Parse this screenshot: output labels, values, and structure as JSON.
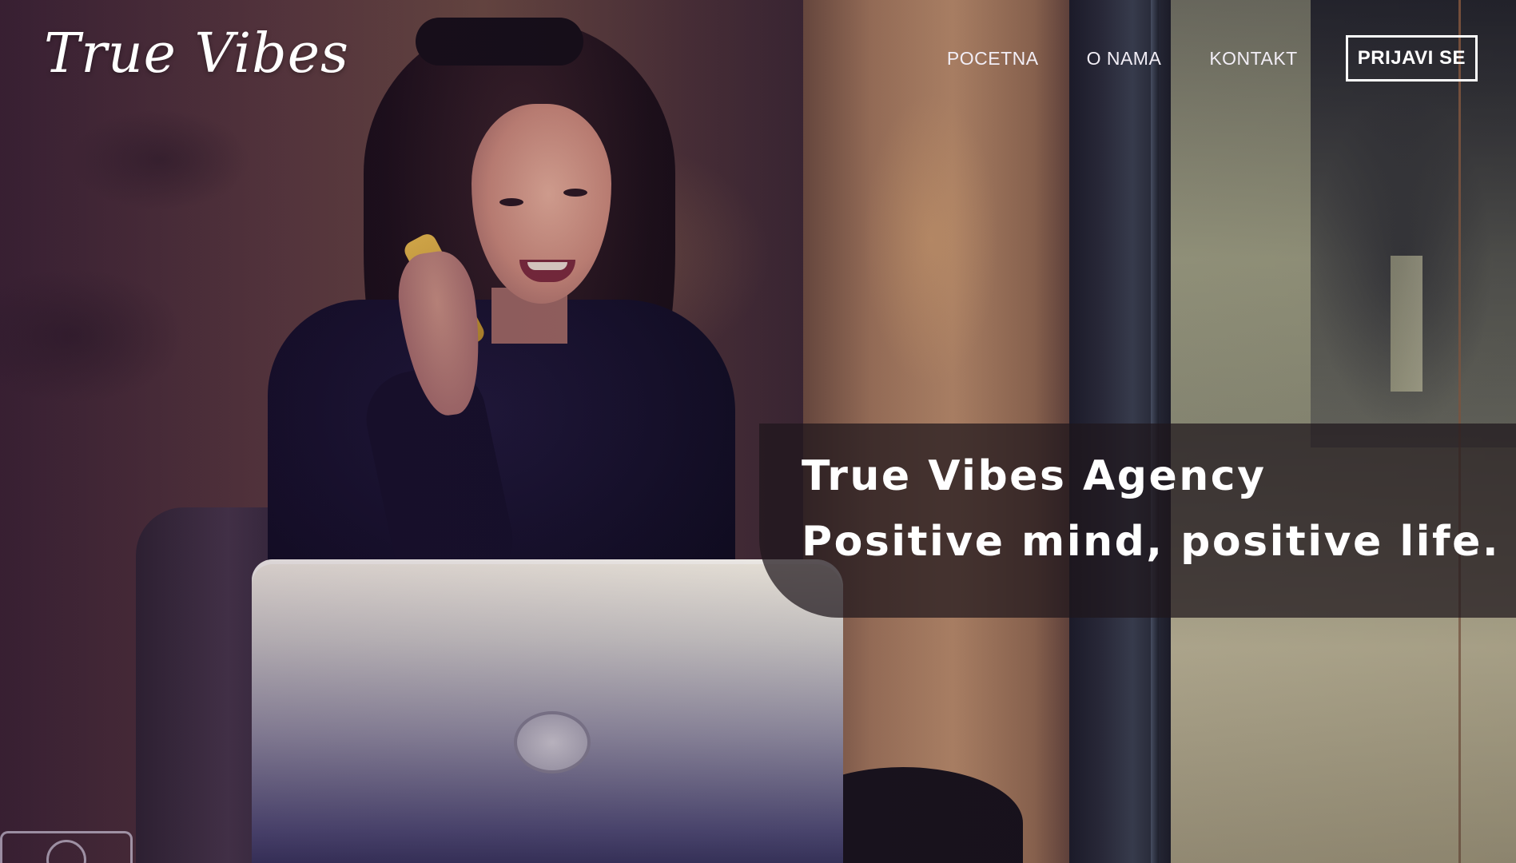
{
  "header": {
    "logo_text": "True Vibes"
  },
  "nav": {
    "items": [
      {
        "label": "POCETNA"
      },
      {
        "label": "O NAMA"
      },
      {
        "label": "KONTAKT"
      }
    ],
    "login_label": "PRIJAVI SE"
  },
  "hero": {
    "headline_line1": "True Vibes Agency",
    "headline_line2": "Positive mind, positive life.",
    "background_icons": [
      "camera-icon",
      "dell-logo-icon"
    ]
  },
  "colors": {
    "text": "#ffffff",
    "panel_overlay": "rgba(30,22,28,0.72)"
  }
}
